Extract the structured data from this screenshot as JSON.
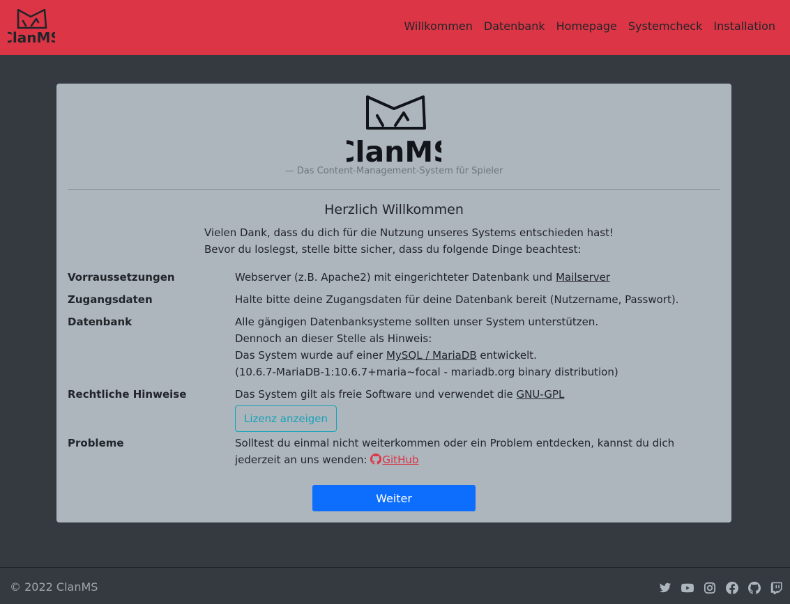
{
  "brand": {
    "name": "ClanMS",
    "logo_color": "#212529"
  },
  "nav": {
    "items": [
      {
        "label": "Willkommen"
      },
      {
        "label": "Datenbank"
      },
      {
        "label": "Homepage"
      },
      {
        "label": "Systemcheck"
      },
      {
        "label": "Installation"
      }
    ]
  },
  "hero": {
    "tagline": "— Das Content-Management-System für Spieler"
  },
  "welcome": {
    "title": "Herzlich Willkommen",
    "intro_line1": "Vielen Dank, dass du dich für die Nutzung unseres Systems entschieden hast!",
    "intro_line2": "Bevor du loslegst, stelle bitte sicher, dass du folgende Dinge beachtest:"
  },
  "rows": {
    "requirements": {
      "label": "Vorraussetzungen",
      "text": "Webserver (z.B. Apache2) mit eingerichteter Datenbank und ",
      "link": "Mailserver"
    },
    "credentials": {
      "label": "Zugangsdaten",
      "text": "Halte bitte deine Zugangsdaten für deine Datenbank bereit (Nutzername, Passwort)."
    },
    "database": {
      "label": "Datenbank",
      "line1": "Alle gängigen Datenbanksysteme sollten unser System unterstützen.",
      "line2": "Dennoch an dieser Stelle als Hinweis:",
      "line3_pre": "Das System wurde auf einer ",
      "line3_link": "MySQL / MariaDB",
      "line3_post": " entwickelt.",
      "line4": "(10.6.7-MariaDB-1:10.6.7+maria~focal - mariadb.org binary distribution)"
    },
    "legal": {
      "label": "Rechtliche Hinweise",
      "text": "Das System gilt als freie Software und verwendet die ",
      "link": "GNU-GPL",
      "button": "Lizenz anzeigen"
    },
    "problems": {
      "label": "Probleme",
      "text": "Solltest du einmal nicht weiterkommen oder ein Problem entdecken, kannst du dich jederzeit an uns wenden: ",
      "link": "GitHub"
    }
  },
  "actions": {
    "next": "Weiter"
  },
  "footer": {
    "copyright": "© 2022 ClanMS",
    "social": [
      "twitter-icon",
      "youtube-icon",
      "instagram-icon",
      "facebook-icon",
      "github-icon",
      "twitch-icon"
    ]
  },
  "colors": {
    "navbar": "#dc3545",
    "background": "#343a40",
    "card": "#adb5bd",
    "primary": "#0d6efd",
    "info": "#17a2b8",
    "link_danger": "#dc3545"
  }
}
